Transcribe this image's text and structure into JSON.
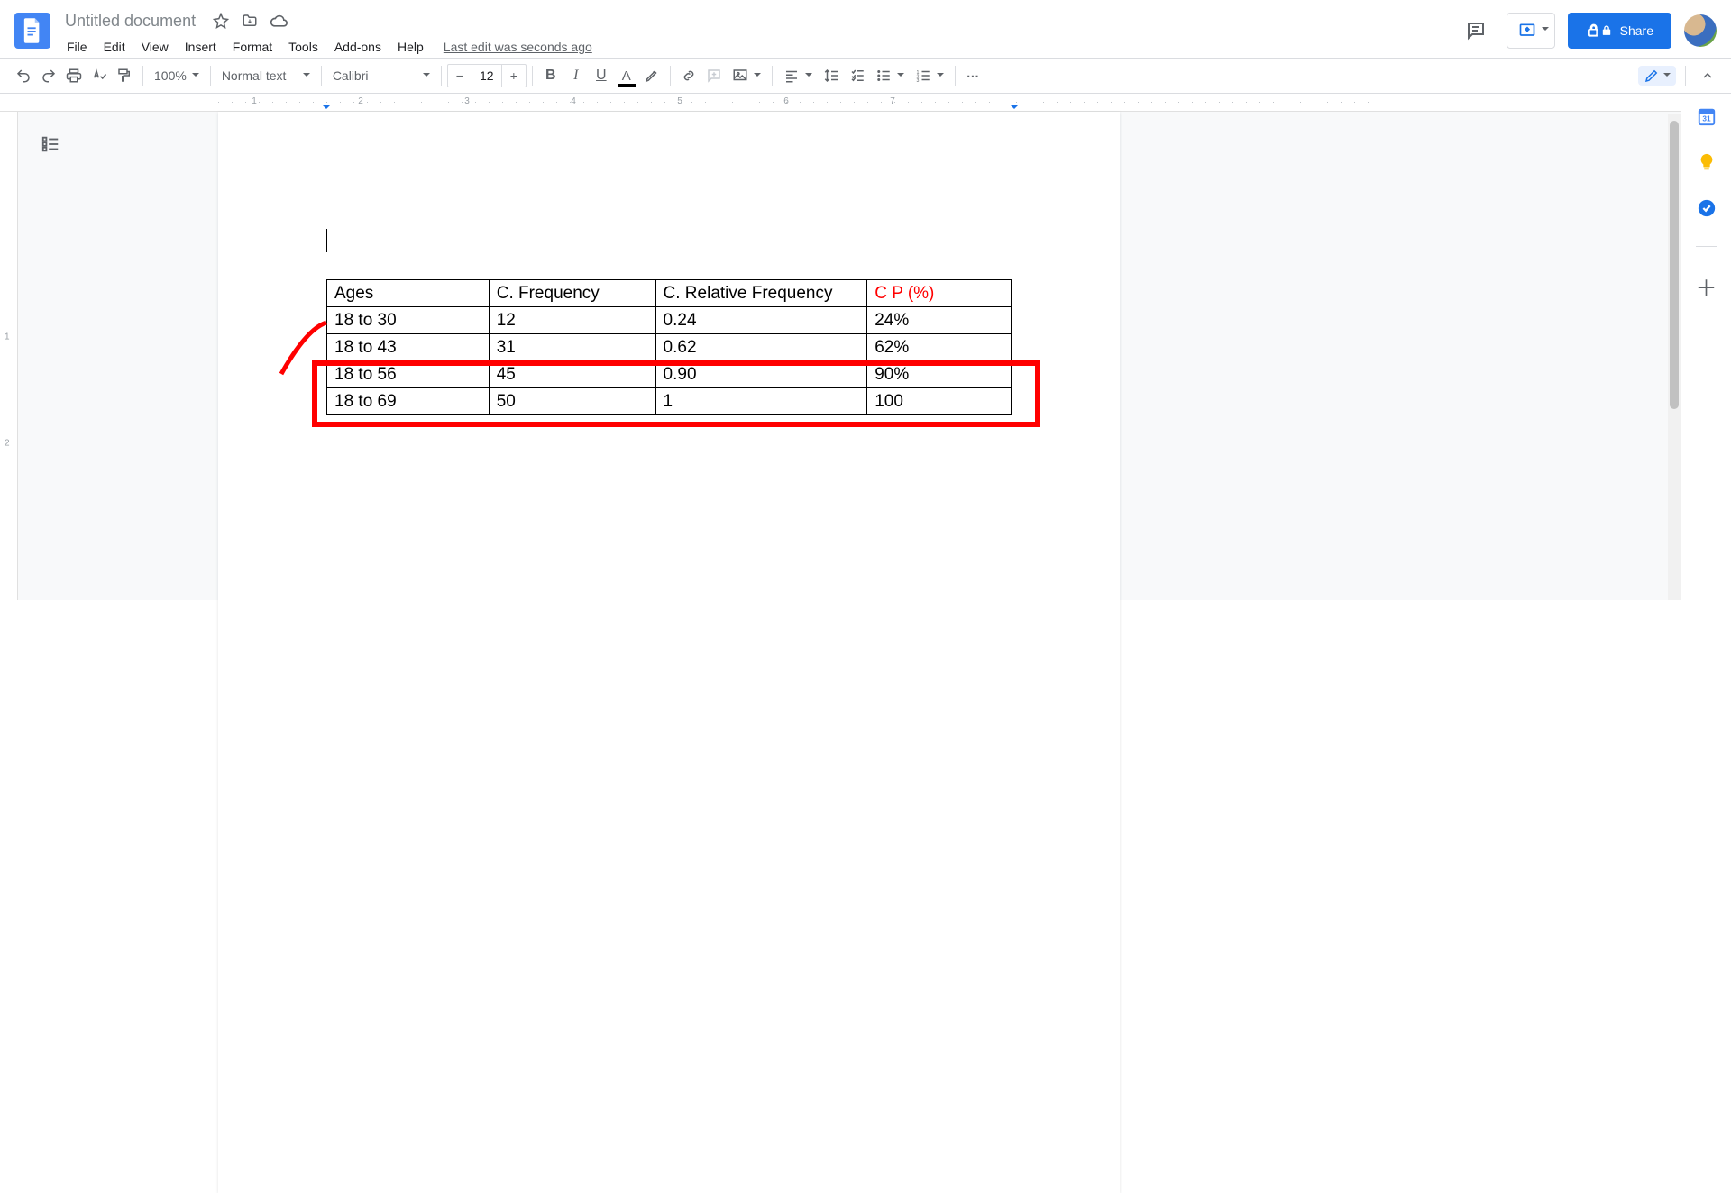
{
  "header": {
    "doc_title": "Untitled document",
    "last_edit": "Last edit was seconds ago",
    "share_label": "Share"
  },
  "menubar": [
    "File",
    "Edit",
    "View",
    "Insert",
    "Format",
    "Tools",
    "Add-ons",
    "Help"
  ],
  "toolbar": {
    "zoom": "100%",
    "style": "Normal text",
    "font": "Calibri",
    "font_size": "12"
  },
  "ruler": {
    "h_numbers": [
      "1",
      "2",
      "3",
      "4",
      "5",
      "6",
      "7"
    ],
    "v_numbers": [
      "1",
      "2"
    ]
  },
  "document": {
    "table": {
      "headers": [
        "Ages",
        "C. Frequency",
        "C. Relative Frequency",
        "C P (%)"
      ],
      "rows": [
        [
          "18 to 30",
          "12",
          "0.24",
          "24%"
        ],
        [
          "18 to 43",
          "31",
          "0.62",
          "62%"
        ],
        [
          "18 to 56",
          "45",
          "0.90",
          "90%"
        ],
        [
          "18 to 69",
          "50",
          "1",
          "100"
        ]
      ]
    }
  },
  "side_panel": {
    "calendar_day": "31"
  }
}
